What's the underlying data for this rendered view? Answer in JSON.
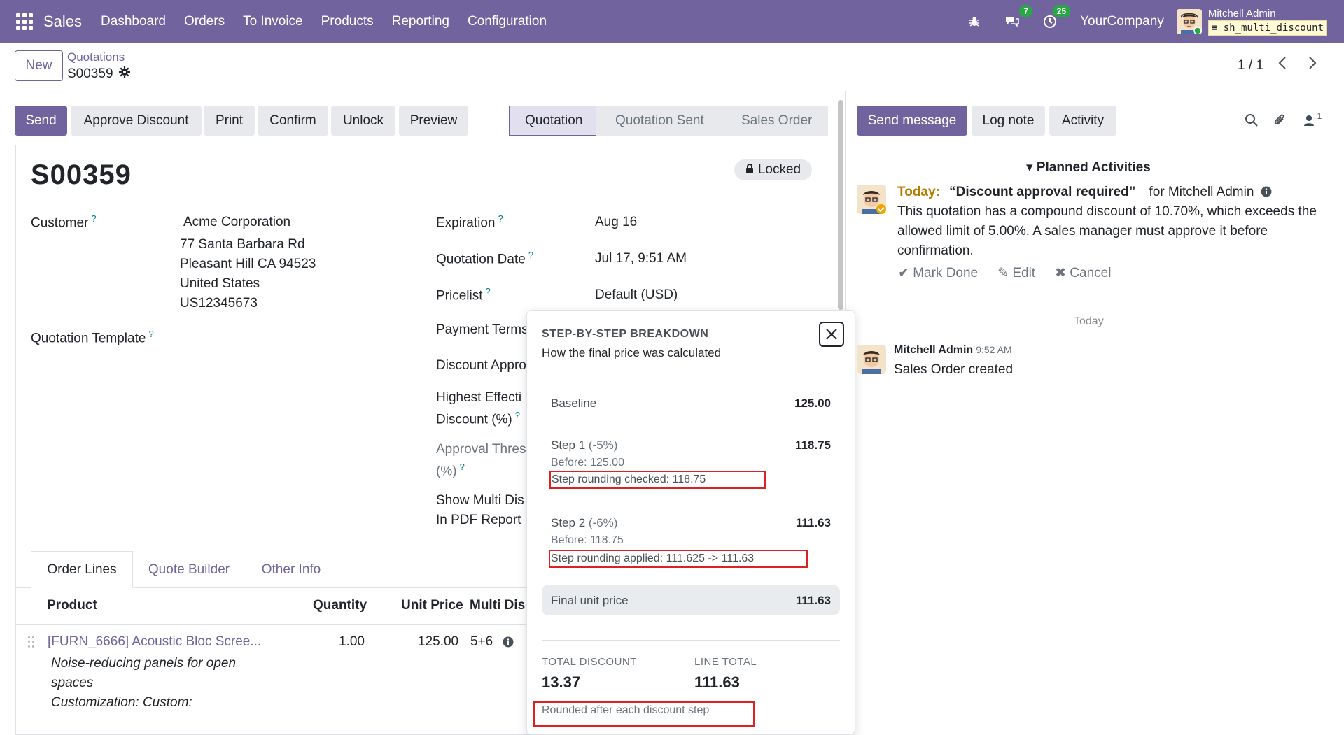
{
  "navbar": {
    "app_name": "Sales",
    "menu": [
      "Dashboard",
      "Orders",
      "To Invoice",
      "Products",
      "Reporting",
      "Configuration"
    ],
    "messages_count": "7",
    "activities_count": "25",
    "company": "YourCompany",
    "user_name": "Mitchell Admin",
    "database": "sh_multi_discount"
  },
  "control": {
    "new_label": "New",
    "breadcrumb": "Quotations",
    "record": "S00359",
    "pager": "1 / 1"
  },
  "actions": {
    "send": "Send",
    "approve_discount": "Approve Discount",
    "print": "Print",
    "confirm": "Confirm",
    "unlock": "Unlock",
    "preview": "Preview"
  },
  "stages": [
    "Quotation",
    "Quotation Sent",
    "Sales Order"
  ],
  "form": {
    "title": "S00359",
    "locked_label": "Locked",
    "customer_label": "Customer",
    "customer_name": "Acme Corporation",
    "customer_address": [
      "77 Santa Barbara Rd",
      "Pleasant Hill CA 94523",
      "United States",
      "US12345673"
    ],
    "template_label": "Quotation Template",
    "expiration_label": "Expiration",
    "expiration_value": "Aug 16",
    "quotation_date_label": "Quotation Date",
    "quotation_date_value": "Jul 17, 9:51 AM",
    "pricelist_label": "Pricelist",
    "pricelist_value": "Default (USD)",
    "payment_terms_label": "Payment Terms",
    "discount_approval_label": "Discount Appro",
    "highest_effective_label_1": "Highest Effecti",
    "highest_effective_label_2": "Discount (%)",
    "approval_threshold_label_1": "Approval Thres",
    "approval_threshold_label_2": "(%)",
    "show_multi_label_1": "Show Multi Dis",
    "show_multi_label_2": "In PDF Report"
  },
  "tabs": [
    "Order Lines",
    "Quote Builder",
    "Other Info"
  ],
  "order_lines": {
    "headers": {
      "product": "Product",
      "quantity": "Quantity",
      "unit_price": "Unit Price",
      "multi_disc": "Multi Disc"
    },
    "rows": [
      {
        "product": "[FURN_6666] Acoustic Bloc Scree...",
        "quantity": "1.00",
        "unit_price": "125.00",
        "multi_disc": "5+6",
        "description": [
          "Noise-reducing panels for open",
          "spaces",
          "Customization: Custom:"
        ]
      }
    ]
  },
  "popover": {
    "title": "STEP-BY-STEP BREAKDOWN",
    "subtitle": "How the final price was calculated",
    "baseline_label": "Baseline",
    "baseline_value": "125.00",
    "step1_label": "Step 1",
    "step1_pct": "(-5%)",
    "step1_value": "118.75",
    "step1_before": "Before: 125.00",
    "step1_rounding": "Step rounding checked: 118.75",
    "step2_label": "Step 2",
    "step2_pct": "(-6%)",
    "step2_value": "111.63",
    "step2_before": "Before: 118.75",
    "step2_rounding": "Step rounding applied: 111.625 -> 111.63",
    "final_label": "Final unit price",
    "final_value": "111.63",
    "total_discount_label": "TOTAL DISCOUNT",
    "total_discount_value": "13.37",
    "line_total_label": "LINE TOTAL",
    "line_total_value": "111.63",
    "rounding_note": "Rounded after each discount step"
  },
  "chatter": {
    "send_message": "Send message",
    "log_note": "Log note",
    "activity": "Activity",
    "followers_count": "1",
    "planned_activities": "Planned Activities",
    "activity_today": "Today:",
    "activity_summary": "“Discount approval required”",
    "activity_for": "for Mitchell Admin",
    "activity_body": "This quotation has a compound discount of 10.70%, which exceeds the allowed limit of 5.00%. A sales manager must approve it before confirmation.",
    "mark_done": "Mark Done",
    "edit": "Edit",
    "cancel": "Cancel",
    "today_separator": "Today",
    "msg_author": "Mitchell Admin",
    "msg_time": "9:52 AM",
    "msg_body": "Sales Order created"
  },
  "colors": {
    "brand": "#71639e",
    "badge": "#28a745",
    "highlight": "#e02020",
    "activity_today": "#b47d00"
  }
}
